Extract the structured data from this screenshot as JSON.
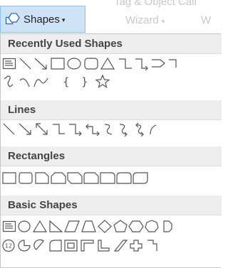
{
  "ribbon": {
    "shapes_label": "Shapes",
    "dropdown_glyph": "▾",
    "faded_top_text": "Tag & Object Call",
    "faded_wizard_text": "Wizard",
    "faded_wizard_arrow": "▾",
    "faded_w_text": "W"
  },
  "gallery": {
    "sections": [
      {
        "title": "Recently Used Shapes"
      },
      {
        "title": "Lines"
      },
      {
        "title": "Rectangles"
      },
      {
        "title": "Basic Shapes"
      }
    ],
    "recent_row2_text": {
      "left_brace": "{",
      "right_brace": "}"
    },
    "basic_row2_badge": "12"
  },
  "icons": {
    "shapes_button_icon": "shapes-icon",
    "dropdown_icon": "chevron-down-icon"
  },
  "colors": {
    "button_bg": "#cfe3f7",
    "button_border": "#91bde6",
    "section_header_bg": "#eeeeee",
    "shape_stroke": "#555555"
  }
}
